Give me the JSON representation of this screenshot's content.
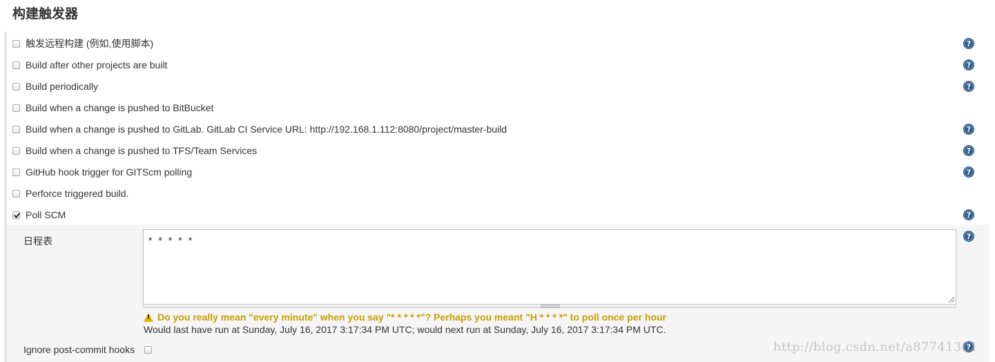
{
  "section": {
    "title": "构建触发器"
  },
  "triggers": [
    {
      "label": "触发远程构建 (例如,使用脚本)",
      "checked": false,
      "help": true
    },
    {
      "label": "Build after other projects are built",
      "checked": false,
      "help": true
    },
    {
      "label": "Build periodically",
      "checked": false,
      "help": true
    },
    {
      "label": "Build when a change is pushed to BitBucket",
      "checked": false,
      "help": false
    },
    {
      "label": "Build when a change is pushed to GitLab. GitLab CI Service URL: http://192.168.1.112:8080/project/master-build",
      "checked": false,
      "help": true
    },
    {
      "label": "Build when a change is pushed to TFS/Team Services",
      "checked": false,
      "help": true
    },
    {
      "label": "GitHub hook trigger for GITScm polling",
      "checked": false,
      "help": true
    },
    {
      "label": "Perforce triggered build.",
      "checked": false,
      "help": false
    },
    {
      "label": "Poll SCM",
      "checked": true,
      "help": true
    }
  ],
  "poll_scm": {
    "schedule_label": "日程表",
    "schedule_value": "* * * * *",
    "warning": "Do you really mean \"every minute\" when you say \"* * * * *\"? Perhaps you meant \"H * * * *\" to poll once per hour",
    "info": "Would last have run at Sunday, July 16, 2017 3:17:34 PM UTC; would next run at Sunday, July 16, 2017 3:17:34 PM UTC.",
    "ignore_hooks_label": "Ignore post-commit hooks",
    "ignore_hooks_checked": false
  },
  "help_icon_text": "?",
  "watermark": "http://blog.csdn.net/a87741361",
  "colors": {
    "help_icon": "#2c5a8a",
    "warning": "#c4a000",
    "panel_bg": "#f5f5f5"
  }
}
